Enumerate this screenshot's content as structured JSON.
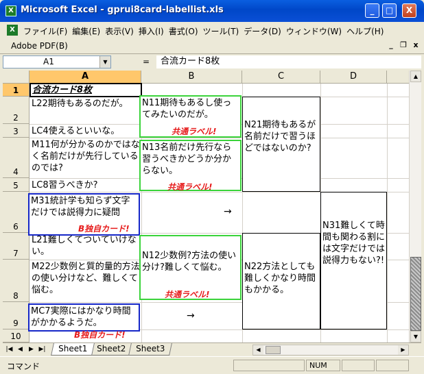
{
  "window": {
    "title": "Microsoft Excel - gprui8card-labellist.xls",
    "minimize": "_",
    "maximize": "□",
    "close": "X"
  },
  "menu": {
    "items": [
      "ファイル(F)",
      "編集(E)",
      "表示(V)",
      "挿入(I)",
      "書式(O)",
      "ツール(T)",
      "データ(D)",
      "ウィンドウ(W)",
      "ヘルプ(H)"
    ],
    "second_row": "Adobe PDF(B)",
    "mdi_minimize": "_",
    "mdi_restore": "❐",
    "mdi_close": "x"
  },
  "formula_bar": {
    "name_box": "A1",
    "equals": "=",
    "content": "合流カード8枚"
  },
  "columns": [
    "A",
    "B",
    "C",
    "D"
  ],
  "rows": [
    "1",
    "2",
    "3",
    "4",
    "5",
    "6",
    "7",
    "8",
    "9",
    "10"
  ],
  "cells": {
    "a1": "合流カード8枚",
    "a2": "L22期待もあるのだが。",
    "a3": "LC4使えるといいな。",
    "a4": "M11何が分かるのかではなく名前だけが先行しているのでは?",
    "a5": "LC8習うべきか?",
    "a6": "M31統計学も知らず文字だけでは説得力に疑問",
    "a7": "L21難しくてついていけない。",
    "a8": "M22少数例と質的量的方法の使い分けなど、難しくて悩む。",
    "a9": "MC7実際にはかなり時間がかかるようだ。",
    "b2": "N11期待もあるし使ってみたいのだが。",
    "b4": "N13名前だけ先行なら習うべきかどうか分からない。",
    "b7": "N12少数例?方法の使い分け?難しくて悩む。",
    "c2": "N21期待もあるが名前だけで習うほどではないのか?",
    "c7": "N22方法としても難しくかなり時間もかかる。",
    "d6": "N31難しくて時間も関わる割には文字だけでは説得力もない?!"
  },
  "labels": {
    "common": "共通ラベル!",
    "b_own": "B独自カード!"
  },
  "arrows": {
    "row6": "→",
    "row9": "→"
  },
  "sheet_tabs": [
    "Sheet1",
    "Sheet2",
    "Sheet3"
  ],
  "status": {
    "mode": "コマンド",
    "num": "NUM"
  },
  "colors": {
    "common_box": "#3ad33a",
    "b_own_box": "#1526c8",
    "label_text": "#e61b1b"
  }
}
